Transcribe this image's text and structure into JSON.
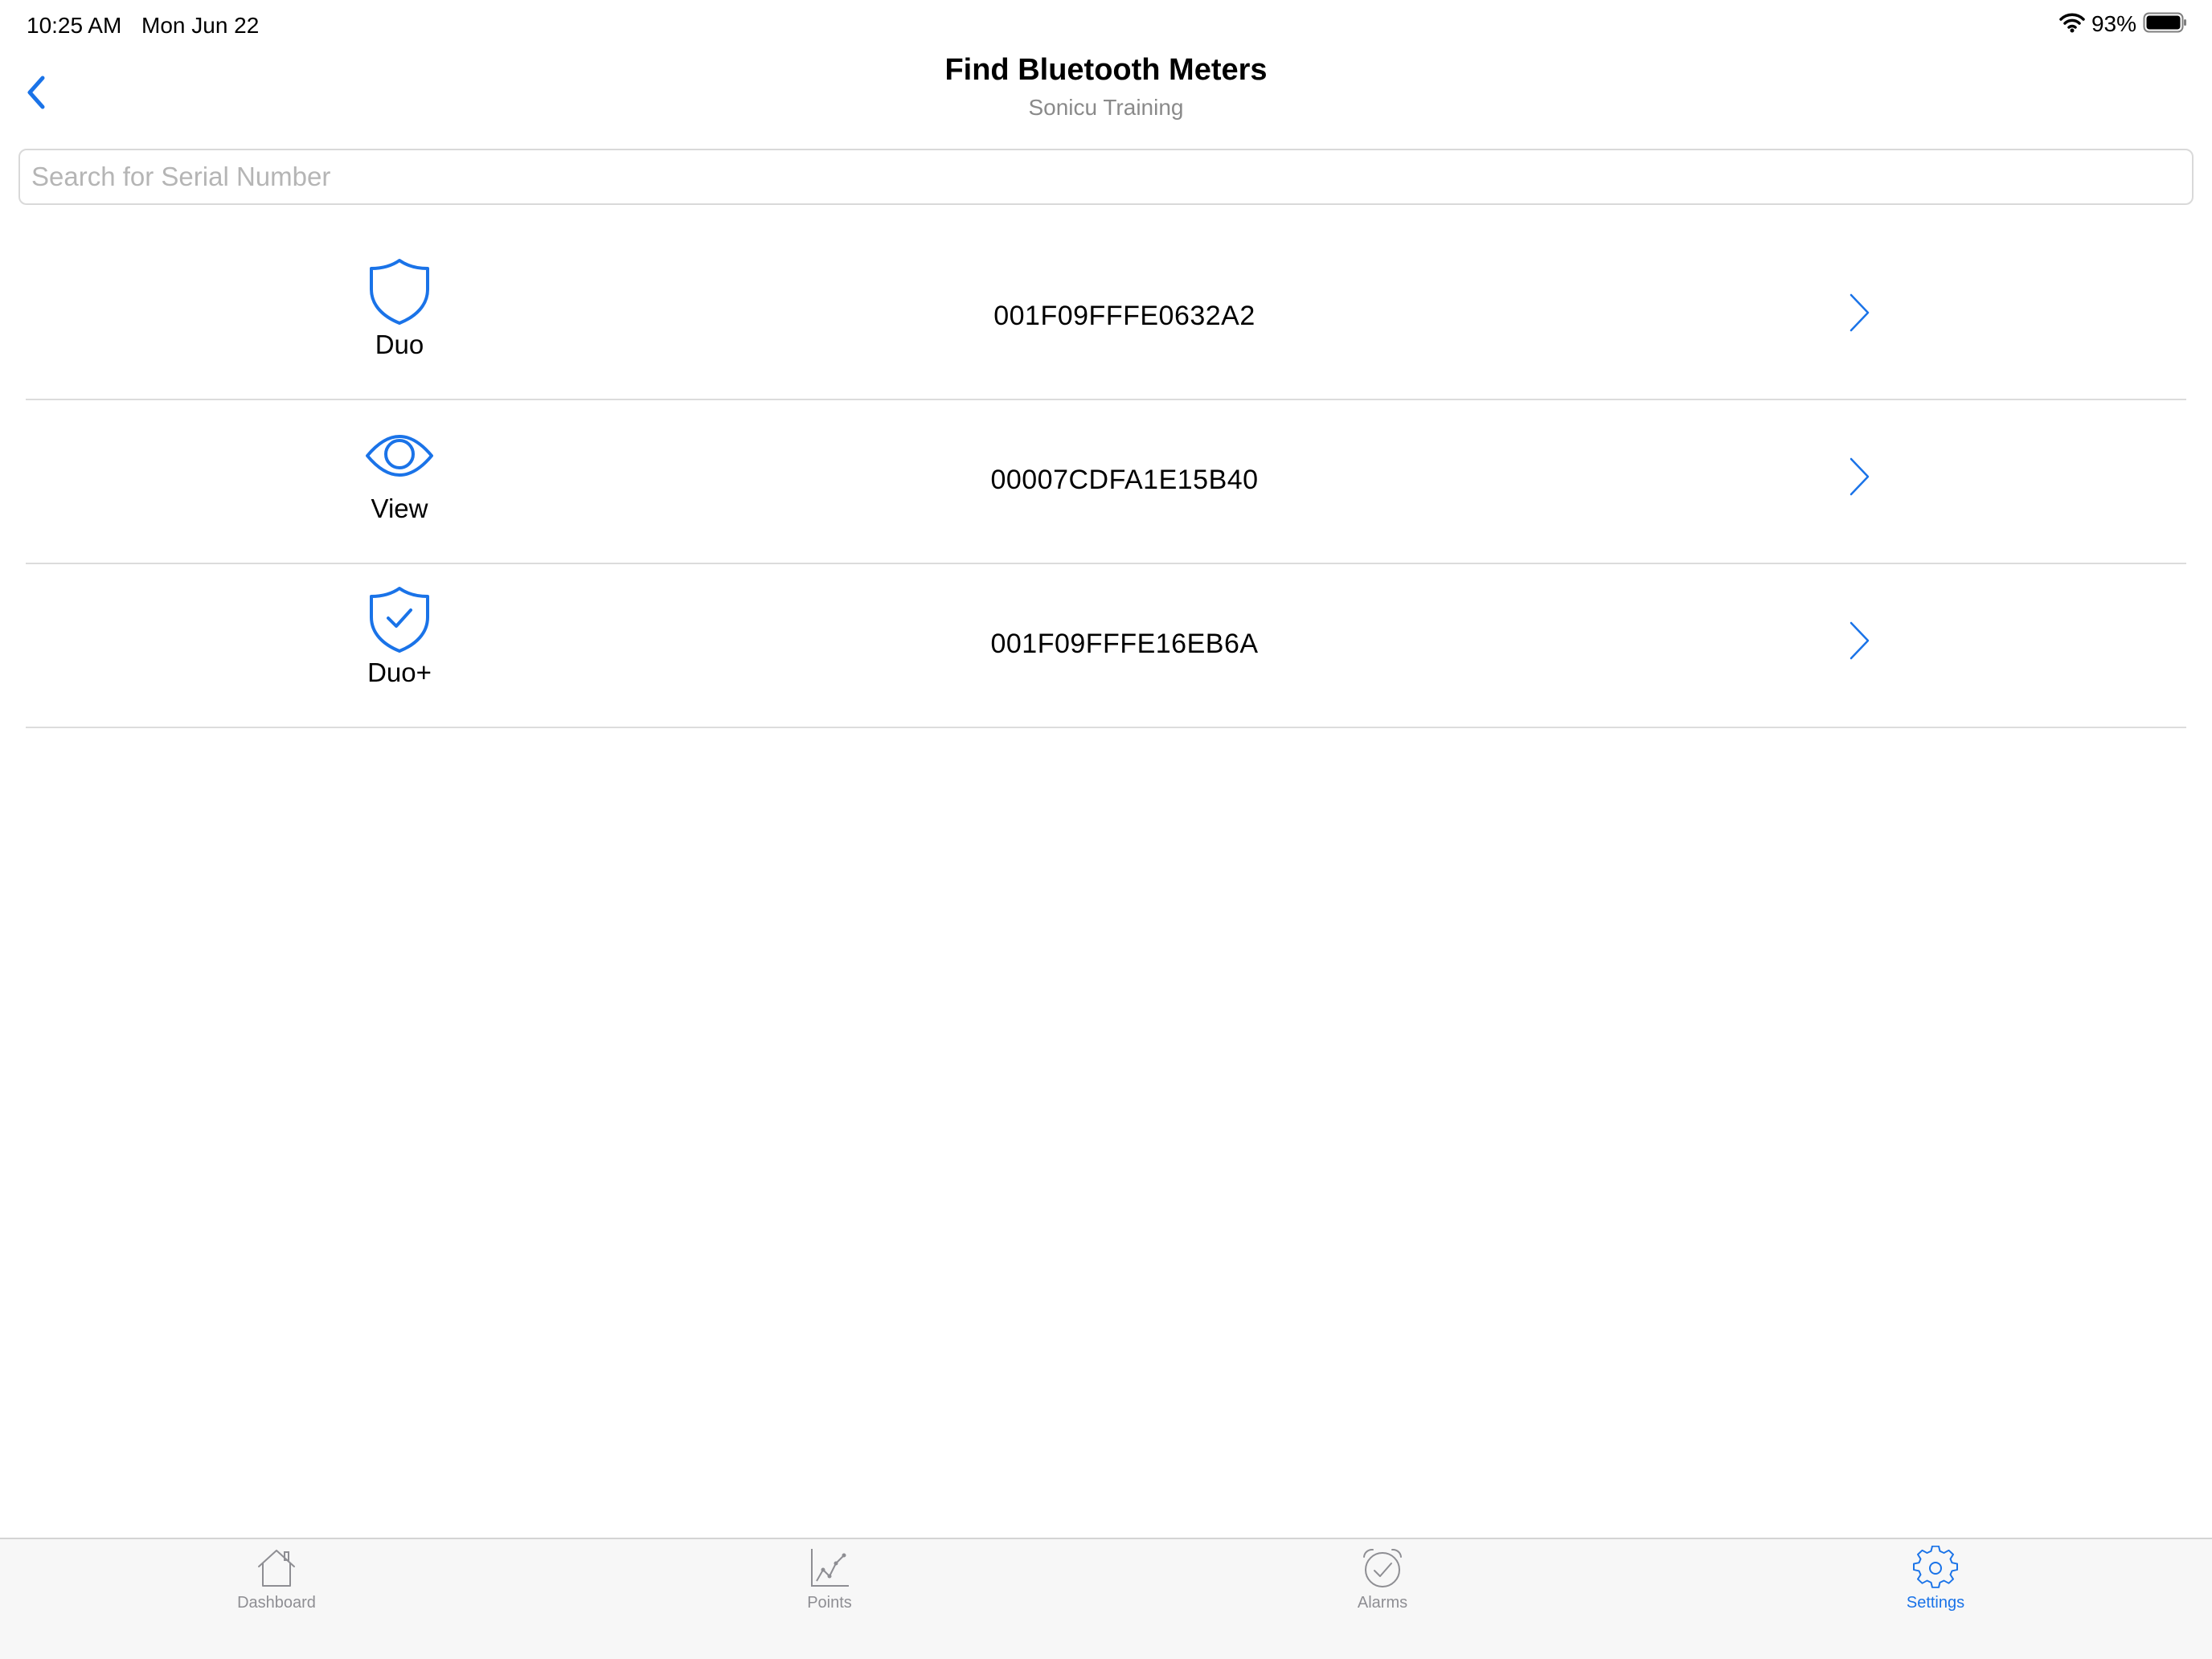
{
  "status_bar": {
    "time": "10:25 AM",
    "date": "Mon Jun 22",
    "battery_percent": "93%",
    "wifi_icon": "wifi-icon",
    "battery_icon": "battery-icon"
  },
  "nav": {
    "back_icon": "chevron-left-icon",
    "title": "Find Bluetooth Meters",
    "subtitle": "Sonicu Training"
  },
  "search": {
    "placeholder": "Search for Serial Number",
    "value": ""
  },
  "meters": [
    {
      "type": "Duo",
      "icon": "shield-icon",
      "serial": "001F09FFFE0632A2"
    },
    {
      "type": "View",
      "icon": "eye-icon",
      "serial": "00007CDFA1E15B40"
    },
    {
      "type": "Duo+",
      "icon": "shield-check-icon",
      "serial": "001F09FFFE16EB6A"
    }
  ],
  "tabs": [
    {
      "label": "Dashboard",
      "icon": "home-icon",
      "active": false
    },
    {
      "label": "Points",
      "icon": "chart-icon",
      "active": false
    },
    {
      "label": "Alarms",
      "icon": "alarm-clock-icon",
      "active": false
    },
    {
      "label": "Settings",
      "icon": "gear-icon",
      "active": true
    }
  ],
  "colors": {
    "accent": "#1a73e8",
    "inactive_tab": "#8e8e93",
    "separator": "#dcdcdc"
  }
}
